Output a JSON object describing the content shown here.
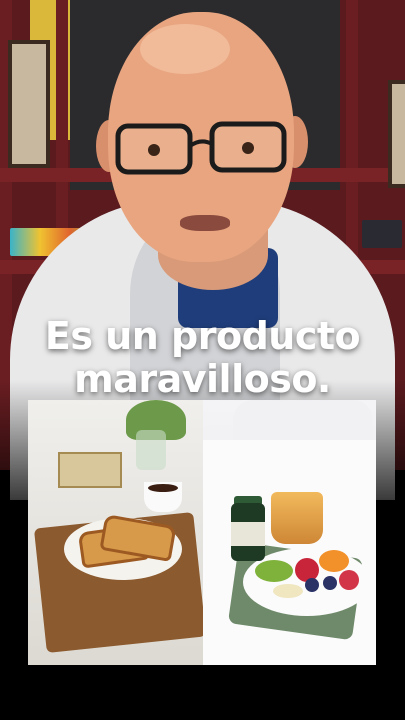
{
  "caption": {
    "line1": "Es un producto",
    "line2": "maravilloso."
  },
  "colors": {
    "background": "#000000",
    "caption_text": "#ffffff",
    "bookshelf": "#5a1a1e",
    "lab_coat": "#e9e9ea",
    "shirt": "#1f3d7a"
  }
}
